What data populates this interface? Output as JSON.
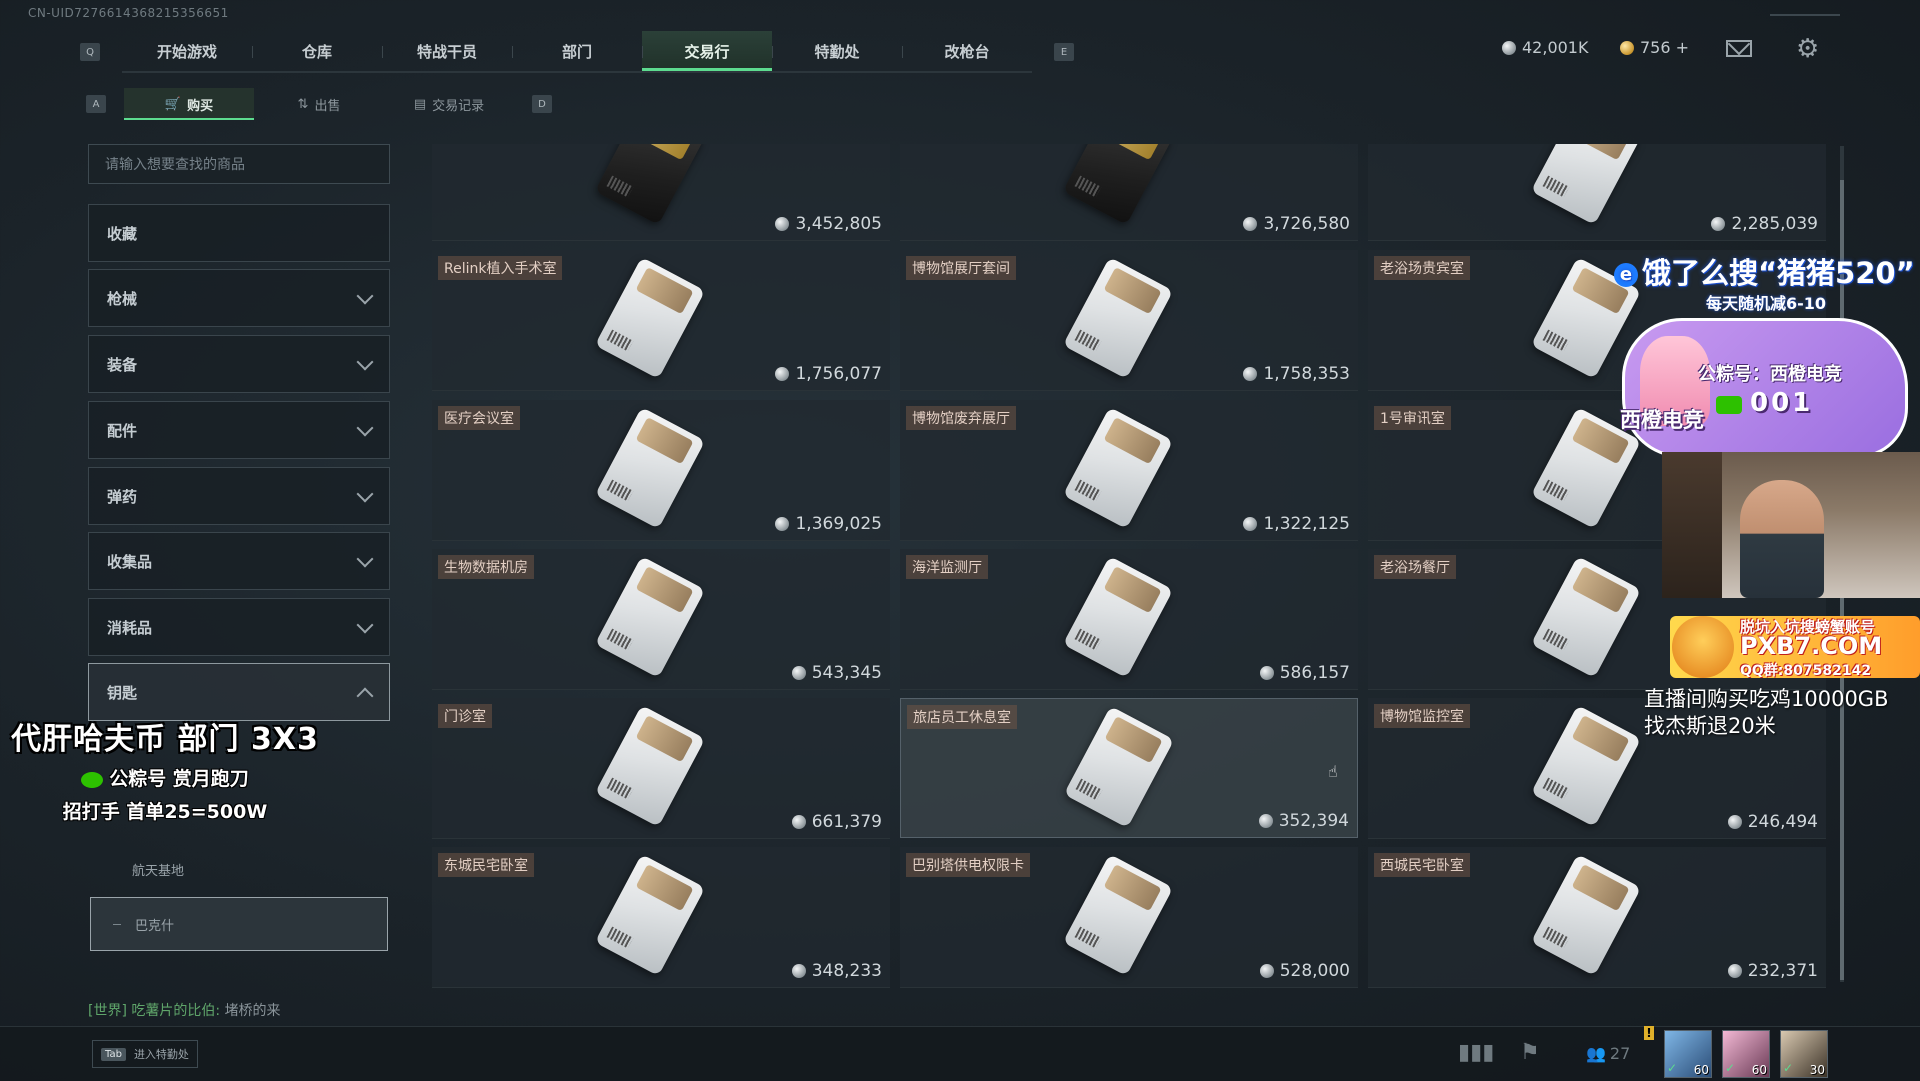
{
  "uid": "CN-UID7276614368215356651",
  "nav": {
    "left_key": "Q",
    "right_key": "E",
    "tabs": [
      "开始游戏",
      "仓库",
      "特战干员",
      "部门",
      "交易行",
      "特勤处",
      "改枪台"
    ],
    "active_tab": "交易行"
  },
  "currency": {
    "silver": "42,001K",
    "gold": "756 +"
  },
  "subnav": {
    "left_key": "A",
    "right_key": "D",
    "tabs": [
      "购买",
      "出售",
      "交易记录"
    ],
    "active_tab": "购买"
  },
  "search": {
    "placeholder": "请输入想要查找的商品"
  },
  "categories": [
    "收藏",
    "枪械",
    "装备",
    "配件",
    "弹药",
    "收集品",
    "消耗品",
    "钥匙"
  ],
  "expanded_category": "钥匙",
  "subcategories": [
    "航天基地",
    "巴克什"
  ],
  "selected_subcategory": "巴克什",
  "items": [
    {
      "name": "",
      "price": "3,452,805",
      "style": "gold"
    },
    {
      "name": "",
      "price": "3,726,580",
      "style": "gold"
    },
    {
      "name": "",
      "price": "2,285,039",
      "style": "white"
    },
    {
      "name": "Relink植入手术室",
      "price": "1,756,077",
      "style": "white"
    },
    {
      "name": "博物馆展厅套间",
      "price": "1,758,353",
      "style": "white"
    },
    {
      "name": "老浴场贵宾室",
      "price": "",
      "style": "white"
    },
    {
      "name": "医疗会议室",
      "price": "1,369,025",
      "style": "white"
    },
    {
      "name": "博物馆废弃展厅",
      "price": "1,322,125",
      "style": "white"
    },
    {
      "name": "1号审讯室",
      "price": "",
      "style": "white"
    },
    {
      "name": "生物数据机房",
      "price": "543,345",
      "style": "white"
    },
    {
      "name": "海洋监测厅",
      "price": "586,157",
      "style": "white"
    },
    {
      "name": "老浴场餐厅",
      "price": "",
      "style": "white"
    },
    {
      "name": "门诊室",
      "price": "661,379",
      "style": "white"
    },
    {
      "name": "旅店员工休息室",
      "price": "352,394",
      "style": "white"
    },
    {
      "name": "博物馆监控室",
      "price": "246,494",
      "style": "white"
    },
    {
      "name": "东城民宅卧室",
      "price": "348,233",
      "style": "white"
    },
    {
      "name": "巴别塔供电权限卡",
      "price": "528,000",
      "style": "white"
    },
    {
      "name": "西城民宅卧室",
      "price": "232,371",
      "style": "white"
    }
  ],
  "chat": {
    "channel": "[世界]",
    "user": "吃薯片的比伯:",
    "message": "堵桥的来"
  },
  "bottom": {
    "tab_key": "Tab",
    "tab_label": "进入特勤处",
    "friends_count": "27",
    "alert": "!"
  },
  "squad": [
    {
      "level": "60"
    },
    {
      "level": "60"
    },
    {
      "level": "30"
    }
  ],
  "overlay": {
    "left_line1": "代肝哈夫币 部门 3X3",
    "left_line2": "公粽号 赏月跑刀",
    "left_line3": "招打手 首单25=500W",
    "eleme_title": "饿了么搜“猪猪520”",
    "eleme_sub": "每天随机减6-10",
    "cloud_line1": "公粽号：西橙电竞",
    "cloud_line2": "西橙电竞",
    "cloud_num": "001",
    "pxb_line1": "脱坑入坑搜螃蟹账号",
    "pxb_line2": "PXB7.COM",
    "pxb_line3": "QQ群:807582142",
    "promo_line1": "直播间购买吃鸡10000GB",
    "promo_line2": "找杰斯退20米"
  }
}
